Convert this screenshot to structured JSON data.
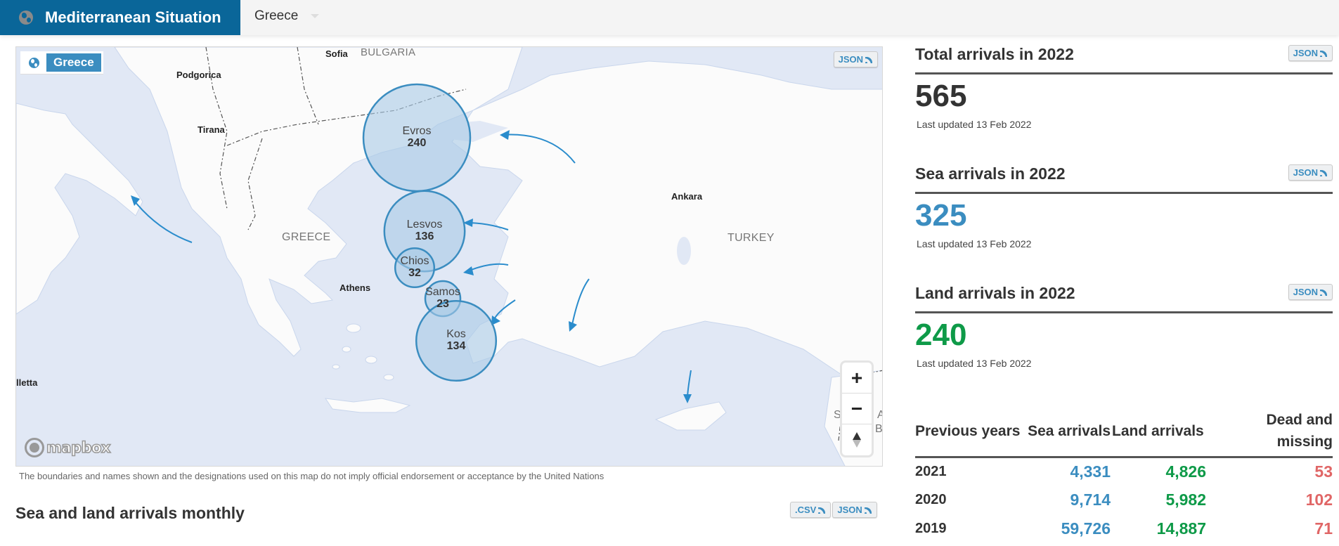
{
  "header": {
    "app_title": "Mediterranean Situation",
    "app_icon": "globe-icon",
    "country_select": {
      "selected": "Greece"
    }
  },
  "map": {
    "badge_label": "Greece",
    "json_button": "JSON",
    "attribution": "mapbox",
    "zoom_in": "+",
    "zoom_out": "−",
    "labels": {
      "sofia": "Sofia",
      "bulgaria": "BULGARIA",
      "podgorica": "Podgorica",
      "tirana": "Tirana",
      "greece": "GREECE",
      "athens": "Athens",
      "ankara": "Ankara",
      "turkey": "TURKEY",
      "valletta": "lletta",
      "syria_fragment": "S",
      "edge_fragment_a": "A",
      "edge_fragment_bl": "BL"
    },
    "bubbles": [
      {
        "name": "Evros",
        "value": "240"
      },
      {
        "name": "Lesvos",
        "value": "136"
      },
      {
        "name": "Chios",
        "value": "32"
      },
      {
        "name": "Samos",
        "value": "23"
      },
      {
        "name": "Kos",
        "value": "134"
      }
    ],
    "colors": {
      "sea": "#e1e8f5",
      "bubble_fill": "#a9c9e6",
      "bubble_stroke": "#3b8dc0",
      "arrow": "#2a8ccc"
    }
  },
  "disclaimer": "The boundaries and names shown and the designations used on this map do not imply official endorsement or acceptance by the United Nations",
  "monthly": {
    "title": "Sea and land arrivals monthly",
    "csv_button": ".CSV",
    "json_button": "JSON"
  },
  "stats": {
    "total": {
      "title": "Total arrivals in 2022",
      "value": "565",
      "updated": "Last updated 13 Feb 2022",
      "json_button": "JSON",
      "color": "#333333"
    },
    "sea": {
      "title": "Sea arrivals in 2022",
      "value": "325",
      "updated": "Last updated 13 Feb 2022",
      "json_button": "JSON",
      "color": "#3b8dc0"
    },
    "land": {
      "title": "Land arrivals in 2022",
      "value": "240",
      "updated": "Last updated 13 Feb 2022",
      "json_button": "JSON",
      "color": "#0e9a48"
    }
  },
  "previous_years": {
    "headers": [
      "Previous years",
      "Sea arrivals",
      "Land arrivals",
      "Dead and missing"
    ],
    "rows": [
      {
        "year": "2021",
        "sea": "4,331",
        "land": "4,826",
        "dead": "53"
      },
      {
        "year": "2020",
        "sea": "9,714",
        "land": "5,982",
        "dead": "102"
      },
      {
        "year": "2019",
        "sea": "59,726",
        "land": "14,887",
        "dead": "71"
      }
    ],
    "colors": {
      "sea": "#3b8dc0",
      "land": "#0e9a48",
      "dead": "#e06666"
    }
  }
}
